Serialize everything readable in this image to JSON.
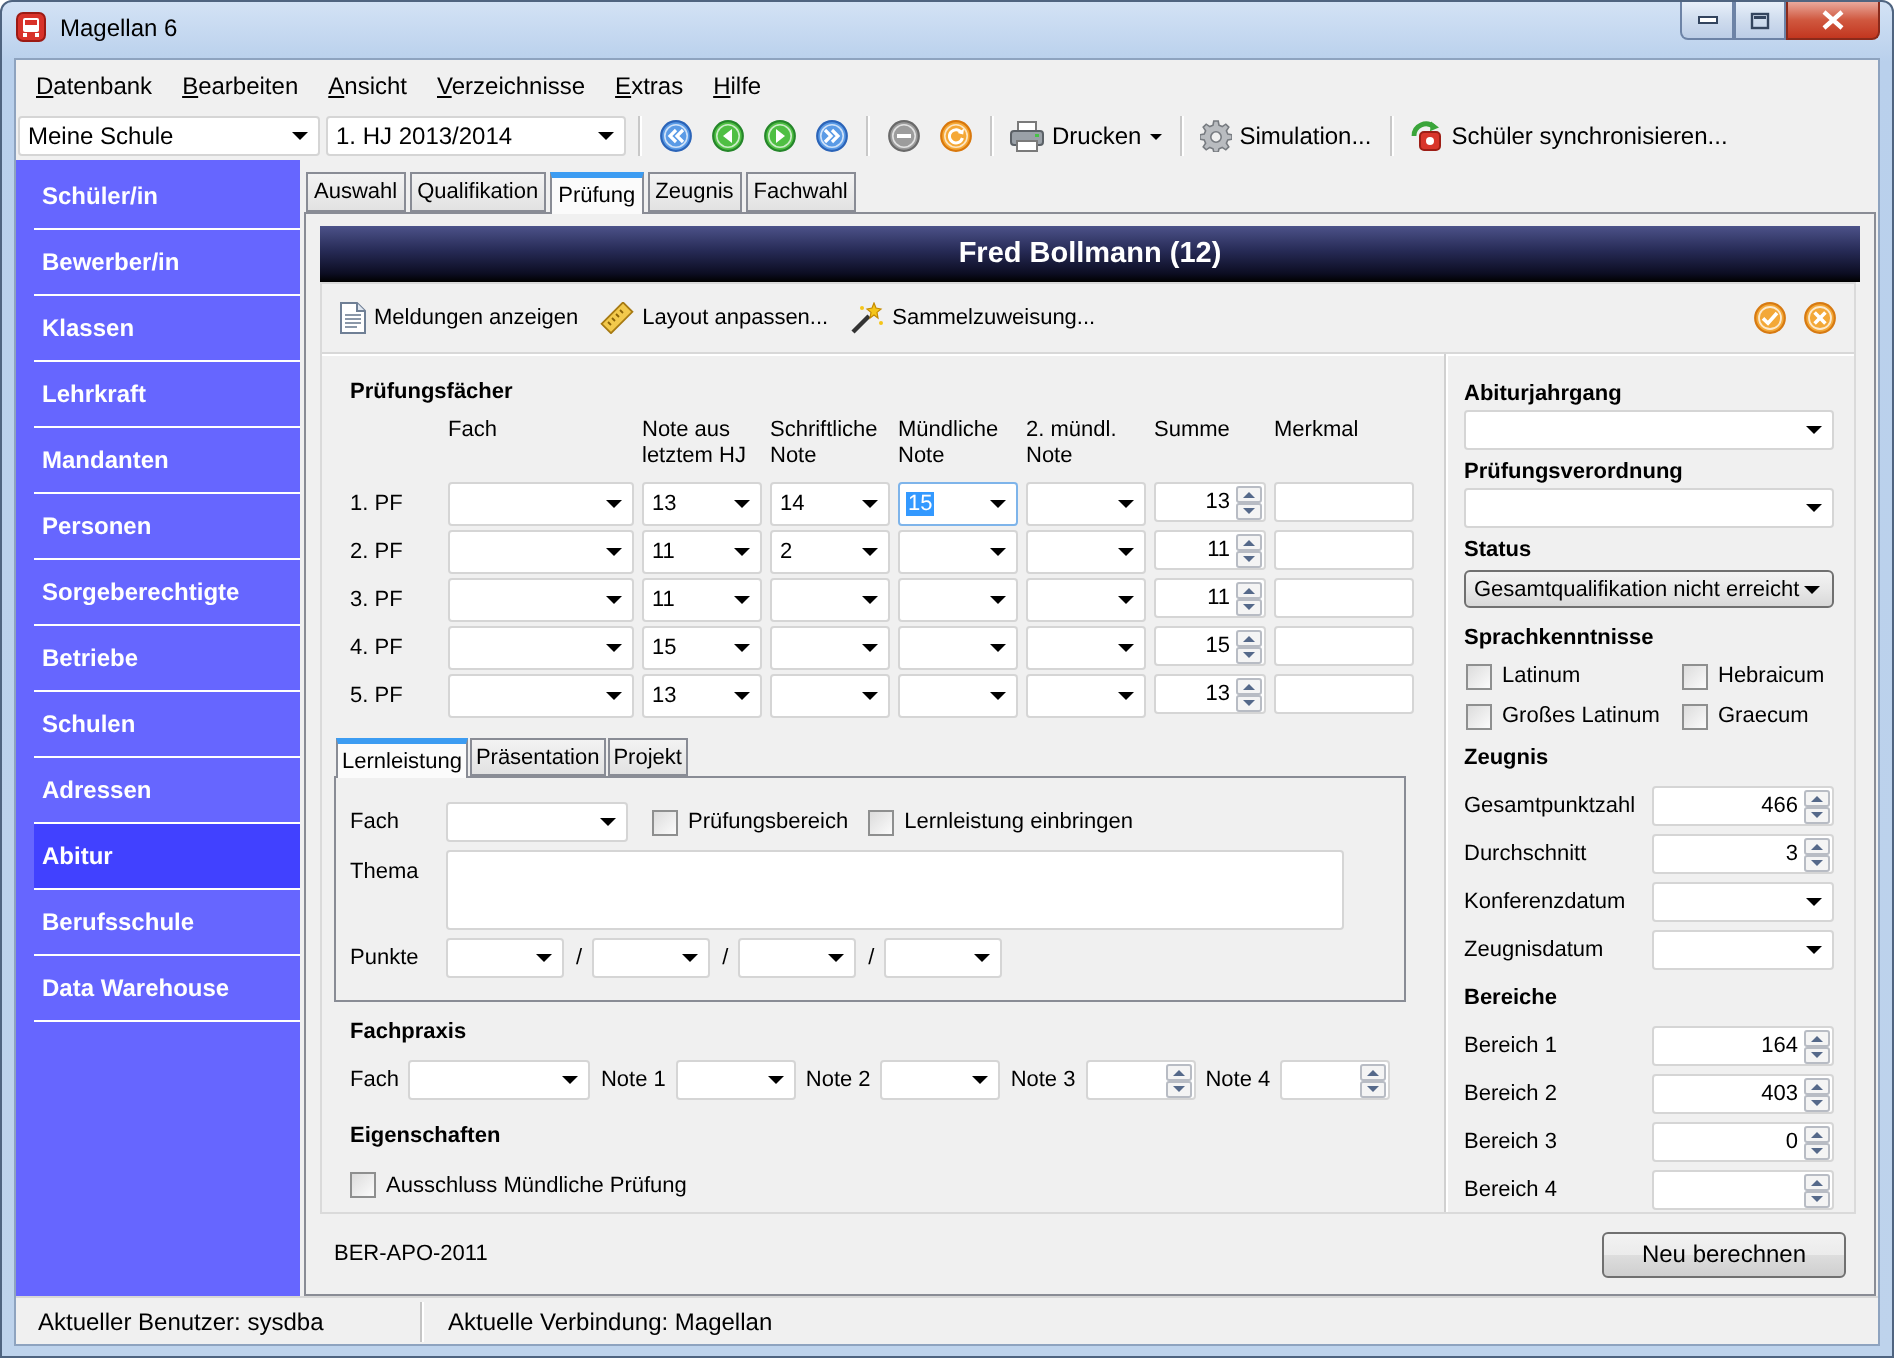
{
  "window": {
    "title": "Magellan 6"
  },
  "menu": [
    "Datenbank",
    "Bearbeiten",
    "Ansicht",
    "Verzeichnisse",
    "Extras",
    "Hilfe"
  ],
  "toolbar": {
    "school": "Meine Schule",
    "term": "1. HJ 2013/2014",
    "groups": [
      [
        {
          "kind": "first"
        },
        {
          "kind": "previous"
        },
        {
          "kind": "next"
        },
        {
          "kind": "last"
        }
      ],
      [
        {
          "kind": "discard"
        },
        {
          "kind": "reload"
        }
      ],
      [
        {
          "kind": "print",
          "label": "Drucken",
          "dropdown": true
        }
      ],
      [
        {
          "kind": "simulation",
          "label": "Simulation...",
          "dropdown": false
        }
      ],
      [
        {
          "kind": "sync",
          "label": "Schüler synchronisieren...",
          "dropdown": false
        }
      ]
    ]
  },
  "sidebar": {
    "items": [
      {
        "label": "Schüler/in",
        "selected": false
      },
      {
        "label": "Bewerber/in",
        "selected": false
      },
      {
        "label": "Klassen",
        "selected": false
      },
      {
        "label": "Lehrkraft",
        "selected": false
      },
      {
        "label": "Mandanten",
        "selected": false
      },
      {
        "label": "Personen",
        "selected": false
      },
      {
        "label": "Sorgeberechtigte",
        "selected": false
      },
      {
        "label": "Betriebe",
        "selected": false
      },
      {
        "label": "Schulen",
        "selected": false
      },
      {
        "label": "Adressen",
        "selected": false
      },
      {
        "label": "Abitur",
        "selected": true
      },
      {
        "label": "Berufsschule",
        "selected": false
      },
      {
        "label": "Data Warehouse",
        "selected": false
      }
    ]
  },
  "tabs": [
    {
      "label": "Auswahl",
      "selected": false
    },
    {
      "label": "Qualifikation",
      "selected": false
    },
    {
      "label": "Prüfung",
      "selected": true
    },
    {
      "label": "Zeugnis",
      "selected": false
    },
    {
      "label": "Fachwahl",
      "selected": false
    }
  ],
  "record": {
    "title": "Fred Bollmann (12)",
    "actions": [
      {
        "kind": "messages",
        "label": "Meldungen anzeigen"
      },
      {
        "kind": "layout",
        "label": "Layout anpassen..."
      },
      {
        "kind": "bulk",
        "label": "Sammelzuweisung..."
      }
    ],
    "confirm_buttons": [
      {
        "kind": "confirm"
      },
      {
        "kind": "cancel"
      }
    ]
  },
  "exam_subjects": {
    "title": "Prüfungsfächer",
    "columns": [
      {
        "label": "Fach",
        "kind": "combo"
      },
      {
        "label": "Note aus letztem HJ",
        "kind": "combo"
      },
      {
        "label": "Schriftliche Note",
        "kind": "combo"
      },
      {
        "label": "Mündliche Note",
        "kind": "combo"
      },
      {
        "label": "2. mündl. Note",
        "kind": "combo"
      },
      {
        "label": "Summe",
        "kind": "spin"
      },
      {
        "label": "Merkmal",
        "kind": "text"
      }
    ],
    "rows": [
      {
        "label": "1. PF",
        "cells": [
          {
            "selected": false
          },
          {
            "value": "13",
            "selected": false
          },
          {
            "value": "14",
            "selected": false
          },
          {
            "value": "15",
            "selected": true
          },
          {
            "selected": false
          },
          {
            "value": "13",
            "selected": false
          },
          {
            "selected": false
          }
        ]
      },
      {
        "label": "2. PF",
        "cells": [
          {
            "selected": false
          },
          {
            "value": "11",
            "selected": false
          },
          {
            "value": "2",
            "selected": false
          },
          {
            "selected": false
          },
          {
            "selected": false
          },
          {
            "value": "11",
            "selected": false
          },
          {
            "selected": false
          }
        ]
      },
      {
        "label": "3. PF",
        "cells": [
          {
            "selected": false
          },
          {
            "value": "11",
            "selected": false
          },
          {
            "selected": false
          },
          {
            "selected": false
          },
          {
            "selected": false
          },
          {
            "value": "11",
            "selected": false
          },
          {
            "selected": false
          }
        ]
      },
      {
        "label": "4. PF",
        "cells": [
          {
            "selected": false
          },
          {
            "value": "15",
            "selected": false
          },
          {
            "selected": false
          },
          {
            "selected": false
          },
          {
            "selected": false
          },
          {
            "value": "15",
            "selected": false
          },
          {
            "selected": false
          }
        ]
      },
      {
        "label": "5. PF",
        "cells": [
          {
            "selected": false
          },
          {
            "value": "13",
            "selected": false
          },
          {
            "selected": false
          },
          {
            "selected": false
          },
          {
            "selected": false
          },
          {
            "value": "13",
            "selected": false
          },
          {
            "selected": false
          }
        ]
      }
    ]
  },
  "sub_tabs": [
    {
      "label": "Lernleistung",
      "selected": true
    },
    {
      "label": "Präsentation",
      "selected": false
    },
    {
      "label": "Projekt",
      "selected": false
    }
  ],
  "learning_achievement": {
    "subject_label": "Fach",
    "checkboxes": [
      {
        "label": "Prüfungsbereich",
        "checked": false
      },
      {
        "label": "Lernleistung einbringen",
        "checked": false
      }
    ],
    "topic_label": "Thema",
    "points": {
      "label": "Punkte",
      "fields": [
        {
          "kind": "combo"
        },
        {
          "kind": "combo",
          "separator": "/"
        },
        {
          "kind": "combo",
          "separator": "/"
        },
        {
          "kind": "combo",
          "separator": "/"
        }
      ]
    }
  },
  "practice": {
    "title": "Fachpraxis",
    "fields": [
      {
        "label": "Fach",
        "kind": "combo"
      },
      {
        "label": "Note 1",
        "kind": "combo"
      },
      {
        "label": "Note 2",
        "kind": "combo"
      },
      {
        "label": "Note 3",
        "kind": "spin"
      },
      {
        "label": "Note 4",
        "kind": "spin"
      }
    ]
  },
  "properties": {
    "title": "Eigenschaften",
    "checkboxes": [
      {
        "label": "Ausschluss Mündliche Prüfung",
        "checked": false
      }
    ]
  },
  "side_panel": [
    {
      "title": "Abiturjahrgang",
      "kind": "combo"
    },
    {
      "title": "Prüfungsverordnung",
      "kind": "combo"
    },
    {
      "title": "Status",
      "kind": "combo_button",
      "value": "Gesamtqualifikation nicht erreicht"
    },
    {
      "title": "Sprachkenntnisse",
      "kind": "checkboxes",
      "items": [
        {
          "label": "Latinum",
          "checked": false
        },
        {
          "label": "Hebraicum",
          "checked": false
        },
        {
          "label": "Großes Latinum",
          "checked": false
        },
        {
          "label": "Graecum",
          "checked": false
        }
      ]
    },
    {
      "title": "Zeugnis",
      "kind": "fields",
      "fields": [
        {
          "label": "Gesamtpunktzahl",
          "kind": "spin",
          "value": "466"
        },
        {
          "label": "Durchschnitt",
          "kind": "spin",
          "value": "3"
        },
        {
          "label": "Konferenzdatum",
          "kind": "combo"
        },
        {
          "label": "Zeugnisdatum",
          "kind": "combo"
        }
      ]
    },
    {
      "title": "Bereiche",
      "kind": "fields",
      "fields": [
        {
          "label": "Bereich 1",
          "kind": "spin",
          "value": "164"
        },
        {
          "label": "Bereich 2",
          "kind": "spin",
          "value": "403"
        },
        {
          "label": "Bereich 3",
          "kind": "spin",
          "value": "0"
        },
        {
          "label": "Bereich 4",
          "kind": "spin"
        }
      ]
    }
  ],
  "footer": {
    "regulation": "BER-APO-2011",
    "button": "Neu berechnen"
  },
  "status_bar": [
    "Aktueller Benutzer: sysdba",
    "Aktuelle Verbindung: Magellan"
  ]
}
